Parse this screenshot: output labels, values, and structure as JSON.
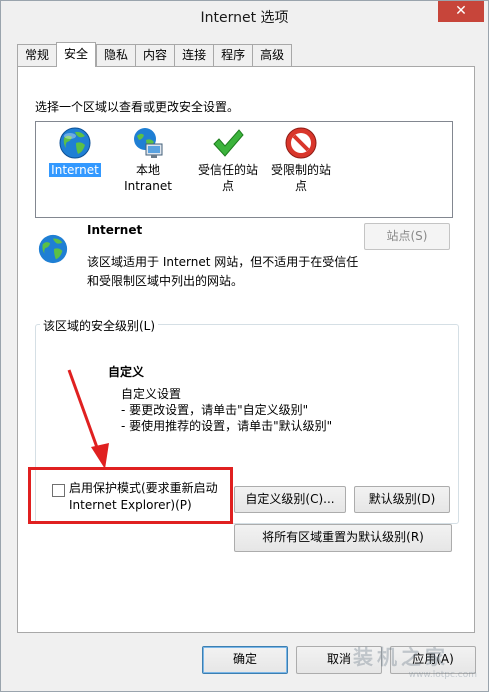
{
  "window": {
    "title": "Internet 选项",
    "close_label": "✕"
  },
  "tabs": [
    {
      "label": "常规"
    },
    {
      "label": "安全"
    },
    {
      "label": "隐私"
    },
    {
      "label": "内容"
    },
    {
      "label": "连接"
    },
    {
      "label": "程序"
    },
    {
      "label": "高级"
    }
  ],
  "security": {
    "select_zone_label": "选择一个区域以查看或更改安全设置。",
    "zones": [
      {
        "name": "Internet",
        "icon": "globe-icon",
        "selected": true
      },
      {
        "name": "本地\nIntranet",
        "icon": "intranet-icon",
        "selected": false
      },
      {
        "name": "受信任的站\n点",
        "icon": "trusted-sites-icon",
        "selected": false
      },
      {
        "name": "受限制的站\n点",
        "icon": "restricted-sites-icon",
        "selected": false
      }
    ],
    "zone_title": "Internet",
    "zone_desc_line1": "该区域适用于 Internet 网站，但不适用于在受信任",
    "zone_desc_line2": "和受限制区域中列出的网站。",
    "sites_button": "站点(S)",
    "level_group_label": "该区域的安全级别(L)",
    "level_title": "自定义",
    "level_line1": "自定义设置",
    "level_line2": "- 要更改设置，请单击\"自定义级别\"",
    "level_line3": "- 要使用推荐的设置，请单击\"默认级别\"",
    "protected_mode_line1": "启用保护模式(要求重新启动",
    "protected_mode_line2": "Internet Explorer)(P)",
    "protected_mode_checked": false,
    "custom_level_button": "自定义级别(C)...",
    "default_level_button": "默认级别(D)",
    "reset_all_button": "将所有区域重置为默认级别(R)"
  },
  "footer": {
    "ok_button": "确定",
    "cancel_button": "取消",
    "apply_button": "应用(A)",
    "watermark": "装机之家",
    "watermark_url": "www.lotpc.com"
  },
  "colors": {
    "selection": "#3399ff",
    "annotation_red": "#e02020",
    "close_red": "#c7453a"
  }
}
